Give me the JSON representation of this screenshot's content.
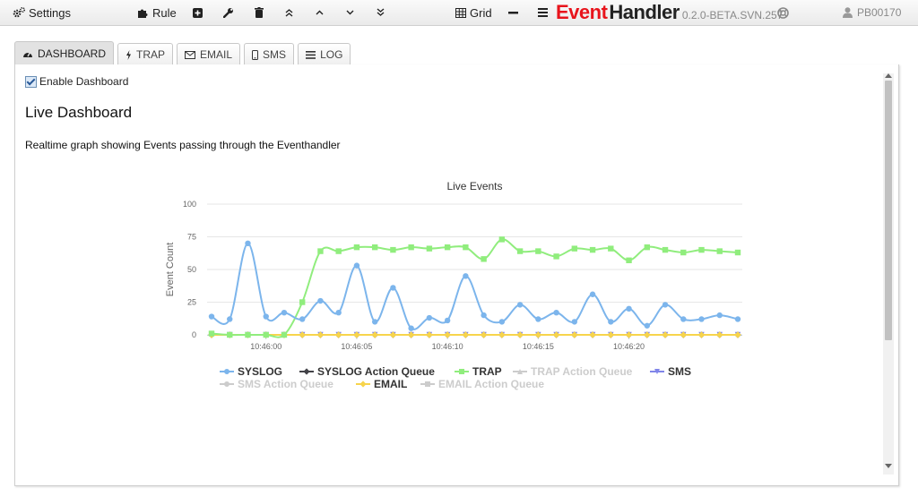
{
  "toolbar": {
    "settings_label": "Settings",
    "rule_label": "Rule",
    "grid_label": "Grid",
    "brand_event": "Event",
    "brand_handler": "Handler",
    "version": "0.2.0-BETA.SVN.257",
    "user": "PB00170"
  },
  "tabs": [
    {
      "label": "DASHBOARD",
      "icon": "dashboard-icon",
      "active": true
    },
    {
      "label": "TRAP",
      "icon": "bolt-icon",
      "active": false
    },
    {
      "label": "EMAIL",
      "icon": "envelope-icon",
      "active": false
    },
    {
      "label": "SMS",
      "icon": "mobile-icon",
      "active": false
    },
    {
      "label": "LOG",
      "icon": "list-icon",
      "active": false
    }
  ],
  "dashboard": {
    "enable_label": "Enable Dashboard",
    "enabled": true,
    "title": "Live Dashboard",
    "description": "Realtime graph showing Events passing through the Eventhandler"
  },
  "chart_data": {
    "type": "line",
    "title": "Live Events",
    "xlabel": "",
    "ylabel": "Event Count",
    "ylim": [
      0,
      100
    ],
    "yticks": [
      0,
      25,
      50,
      75,
      100
    ],
    "x": [
      "10:45:57",
      "10:45:58",
      "10:45:59",
      "10:46:00",
      "10:46:01",
      "10:46:02",
      "10:46:03",
      "10:46:04",
      "10:46:05",
      "10:46:06",
      "10:46:07",
      "10:46:08",
      "10:46:09",
      "10:46:10",
      "10:46:11",
      "10:46:12",
      "10:46:13",
      "10:46:14",
      "10:46:15",
      "10:46:16",
      "10:46:17",
      "10:46:18",
      "10:46:19",
      "10:46:20",
      "10:46:21",
      "10:46:22",
      "10:46:23",
      "10:46:24",
      "10:46:25",
      "10:46:26"
    ],
    "xtick_labels": [
      "10:46:00",
      "10:46:05",
      "10:46:10",
      "10:46:15",
      "10:46:20"
    ],
    "grid": true,
    "legend_position": "bottom",
    "series": [
      {
        "name": "SYSLOG",
        "color": "#7cb5ec",
        "marker": "circle",
        "smooth": true,
        "visible": true,
        "values": [
          14,
          12,
          70,
          14,
          17,
          12,
          26,
          17,
          53,
          10,
          36,
          5,
          13,
          11,
          45,
          15,
          10,
          23,
          12,
          17,
          10,
          31,
          10,
          20,
          7,
          23,
          12,
          12,
          15,
          12
        ]
      },
      {
        "name": "SYSLOG Action Queue",
        "color": "#434348",
        "marker": "diamond",
        "visible": true,
        "values": [
          0,
          0,
          0,
          0,
          0,
          0,
          0,
          0,
          0,
          0,
          0,
          0,
          0,
          0,
          0,
          0,
          0,
          0,
          0,
          0,
          0,
          0,
          0,
          0,
          0,
          0,
          0,
          0,
          0,
          0
        ]
      },
      {
        "name": "TRAP",
        "color": "#90ed7d",
        "marker": "square",
        "visible": true,
        "values": [
          1,
          0,
          0,
          0,
          0,
          25,
          64,
          64,
          67,
          67,
          65,
          67,
          66,
          67,
          67,
          58,
          73,
          64,
          64,
          60,
          66,
          65,
          66,
          57,
          67,
          65,
          63,
          65,
          64,
          63
        ]
      },
      {
        "name": "TRAP Action Queue",
        "color": "#cccccc",
        "marker": "triangle",
        "visible": false,
        "values": []
      },
      {
        "name": "SMS",
        "color": "#8085e9",
        "marker": "triangle-down",
        "visible": true,
        "values": [
          0,
          0,
          0,
          0,
          0,
          0,
          0,
          0,
          0,
          0,
          0,
          0,
          0,
          0,
          0,
          0,
          0,
          0,
          0,
          0,
          0,
          0,
          0,
          0,
          0,
          0,
          0,
          0,
          0,
          0
        ]
      },
      {
        "name": "SMS Action Queue",
        "color": "#cccccc",
        "marker": "circle",
        "visible": false,
        "values": []
      },
      {
        "name": "EMAIL",
        "color": "#f7d44c",
        "marker": "diamond",
        "visible": true,
        "values": [
          0,
          0,
          0,
          0,
          0,
          0,
          0,
          0,
          0,
          0,
          0,
          0,
          0,
          0,
          0,
          0,
          0,
          0,
          0,
          0,
          0,
          0,
          0,
          0,
          0,
          0,
          0,
          0,
          0,
          0
        ]
      },
      {
        "name": "EMAIL Action Queue",
        "color": "#cccccc",
        "marker": "square",
        "visible": false,
        "values": []
      }
    ]
  }
}
